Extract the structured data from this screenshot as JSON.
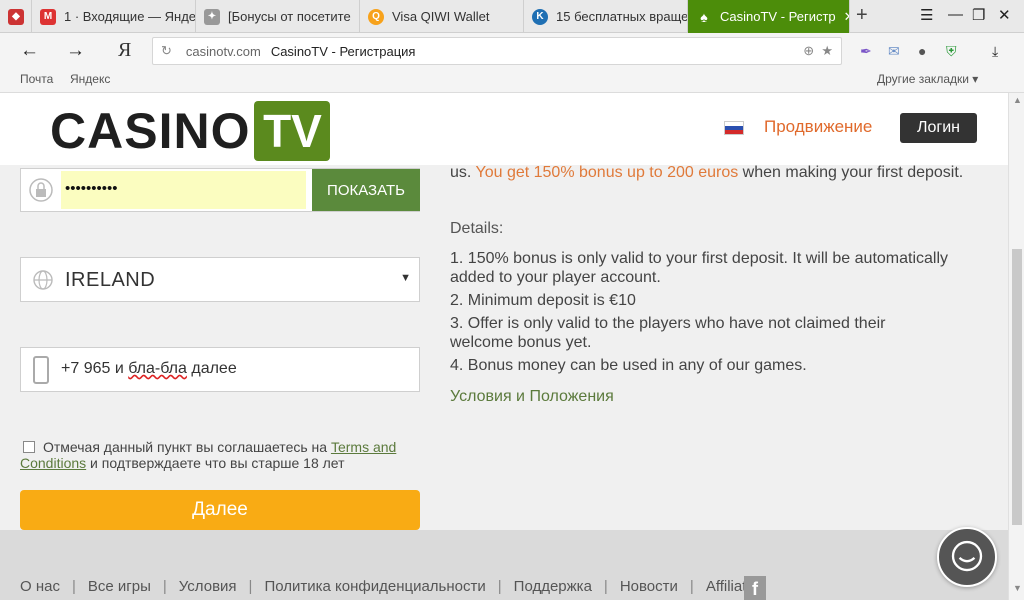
{
  "tabs": [
    {
      "label": "",
      "icon": "site-icon"
    },
    {
      "label": "1 · Входящие — Янде",
      "icon": "mail-icon"
    },
    {
      "label": "[Бонусы от посетите",
      "icon": "forum-icon"
    },
    {
      "label": "Visa QIWI Wallet",
      "icon": "qiwi-icon"
    },
    {
      "label": "15 бесплатных враще",
      "icon": "kf-icon"
    },
    {
      "label": "CasinoTV - Регистр",
      "icon": "casino-icon"
    }
  ],
  "addressbar": {
    "yandex_label": "Я",
    "domain": "casinotv.com",
    "page_title": "CasinoTV - Регистрация"
  },
  "bookmarks": {
    "items": [
      "Почта",
      "Яндекс"
    ],
    "other": "Другие закладки"
  },
  "header": {
    "logo_left": "CASINO",
    "logo_right": "TV",
    "promo_link": "Продвижение",
    "login_button": "Логин"
  },
  "form": {
    "password_value": "••••••••••",
    "show_button": "ПОКАЗАТЬ",
    "country": "IRELAND",
    "phone_value_prefix": "+7 965 и ",
    "phone_value_squiggly": "бла-бла",
    "phone_value_suffix": " далее",
    "agree_text_pre": "Отмечая данный пункт вы соглашаетесь на ",
    "agree_link": "Terms and Conditions",
    "agree_text_post": " и подтверждаете что вы старше 18 лет",
    "next_button": "Далее"
  },
  "offer": {
    "line_start": "us. ",
    "highlight": "You get 150% bonus up to 200 euros",
    "line_end": " when making your first deposit.",
    "details_label": "Details:",
    "items": [
      "1. 150% bonus is only valid to your first deposit. It will be automatically added to your player account.",
      "2. Minimum deposit is €10",
      "3. Offer is only valid to the players who have not claimed their welcome bonus yet.",
      "4. Bonus money can be used in any of our games."
    ],
    "terms_link": "Условия и Положения"
  },
  "footer": {
    "links": [
      "О нас",
      "Все игры",
      "Условия",
      "Политика конфиденциальности",
      "Поддержка",
      "Новости",
      "Affiliates"
    ]
  },
  "colors": {
    "brand_green": "#5b8a1e",
    "accent_orange": "#f9ab14",
    "promo_orange": "#e06a2c",
    "active_tab": "#4c8d0a"
  }
}
